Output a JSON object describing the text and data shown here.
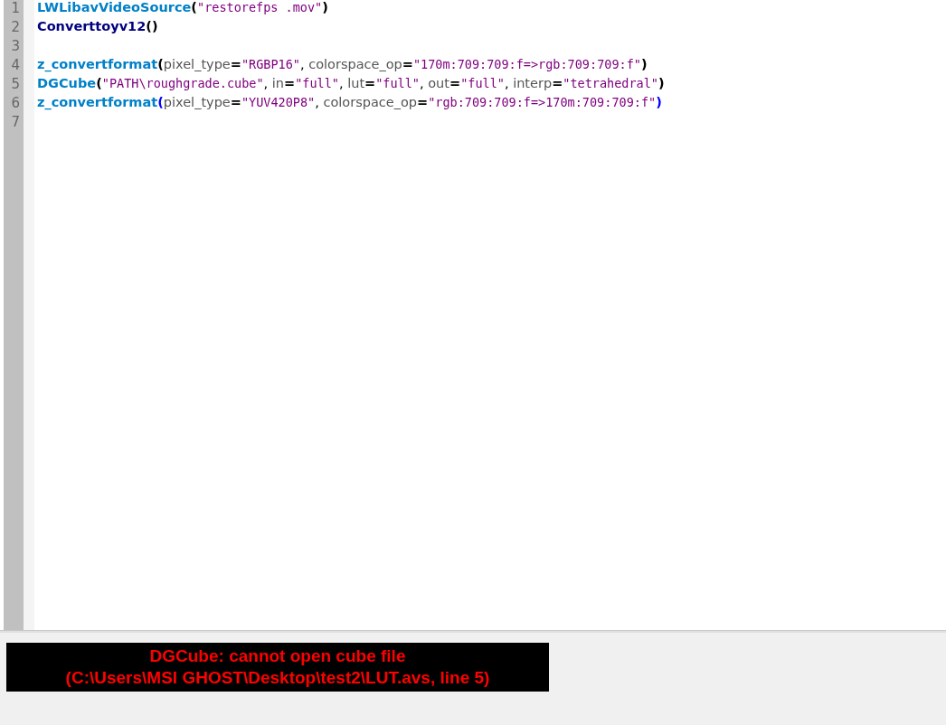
{
  "editor": {
    "lines": [
      {
        "number": "1",
        "tokens": [
          {
            "kind": "func",
            "text": "LWLibavVideoSource"
          },
          {
            "kind": "paren",
            "text": "("
          },
          {
            "kind": "string",
            "text": "\"restorefps .mov\""
          },
          {
            "kind": "paren",
            "text": ")"
          }
        ]
      },
      {
        "number": "2",
        "tokens": [
          {
            "kind": "builtin",
            "text": "Converttoyv12"
          },
          {
            "kind": "paren",
            "text": "()"
          }
        ]
      },
      {
        "number": "3"
      },
      {
        "number": "4",
        "tokens": [
          {
            "kind": "func",
            "text": "z_convertformat"
          },
          {
            "kind": "paren",
            "text": "("
          },
          {
            "kind": "arg",
            "text": "pixel_type"
          },
          {
            "kind": "op",
            "text": "="
          },
          {
            "kind": "string",
            "text": "\"RGBP16\""
          },
          {
            "kind": "punct",
            "text": ", "
          },
          {
            "kind": "arg",
            "text": "colorspace_op"
          },
          {
            "kind": "op",
            "text": "="
          },
          {
            "kind": "string",
            "text": "\"170m:709:709:f=>rgb:709:709:f\""
          },
          {
            "kind": "paren",
            "text": ")"
          }
        ]
      },
      {
        "number": "5",
        "tokens": [
          {
            "kind": "func",
            "text": "DGCube"
          },
          {
            "kind": "paren",
            "text": "("
          },
          {
            "kind": "string",
            "text": "\"PATH\\roughgrade.cube\""
          },
          {
            "kind": "punct",
            "text": ", "
          },
          {
            "kind": "arg",
            "text": "in"
          },
          {
            "kind": "op",
            "text": "="
          },
          {
            "kind": "string",
            "text": "\"full\""
          },
          {
            "kind": "punct",
            "text": ", "
          },
          {
            "kind": "arg",
            "text": "lut"
          },
          {
            "kind": "op",
            "text": "="
          },
          {
            "kind": "string",
            "text": "\"full\""
          },
          {
            "kind": "punct",
            "text": ", "
          },
          {
            "kind": "arg",
            "text": "out"
          },
          {
            "kind": "op",
            "text": "="
          },
          {
            "kind": "string",
            "text": "\"full\""
          },
          {
            "kind": "punct",
            "text": ", "
          },
          {
            "kind": "arg",
            "text": "interp"
          },
          {
            "kind": "op",
            "text": "="
          },
          {
            "kind": "string",
            "text": "\"tetrahedral\""
          },
          {
            "kind": "paren",
            "text": ")"
          }
        ]
      },
      {
        "number": "6",
        "tokens": [
          {
            "kind": "func",
            "text": "z_convertformat"
          },
          {
            "kind": "paren-match",
            "text": "("
          },
          {
            "kind": "arg",
            "text": "pixel_type"
          },
          {
            "kind": "op",
            "text": "="
          },
          {
            "kind": "string",
            "text": "\"YUV420P8\""
          },
          {
            "kind": "punct",
            "text": ", "
          },
          {
            "kind": "arg",
            "text": "colorspace_op"
          },
          {
            "kind": "op",
            "text": "="
          },
          {
            "kind": "string",
            "text": "\"rgb:709:709:f=>170m:709:709:f\""
          },
          {
            "kind": "paren-match",
            "text": ")"
          }
        ]
      },
      {
        "number": "7"
      }
    ]
  },
  "error": {
    "lines": [
      "DGCube: cannot open cube file",
      "(C:\\Users\\MSI GHOST\\Desktop\\test2\\LUT.avs, line 5)"
    ]
  }
}
